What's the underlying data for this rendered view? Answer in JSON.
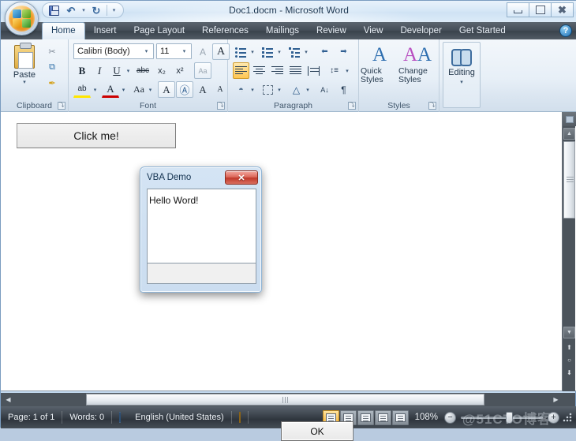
{
  "window": {
    "title": "Doc1.docm - Microsoft Word",
    "controls": {
      "minimize": "minimize-button",
      "maximize": "maximize-button",
      "close": "close-button"
    }
  },
  "quick_access": {
    "items": [
      {
        "name": "save",
        "icon": "save-icon"
      },
      {
        "name": "undo",
        "icon": "undo-icon",
        "glyph": "↶"
      },
      {
        "name": "redo",
        "icon": "redo-icon",
        "glyph": "↻"
      },
      {
        "name": "customize",
        "icon": "chevron-down-icon",
        "glyph": "▾"
      }
    ]
  },
  "ribbon": {
    "tabs": [
      {
        "label": "Home",
        "active": true
      },
      {
        "label": "Insert",
        "active": false
      },
      {
        "label": "Page Layout",
        "active": false
      },
      {
        "label": "References",
        "active": false
      },
      {
        "label": "Mailings",
        "active": false
      },
      {
        "label": "Review",
        "active": false
      },
      {
        "label": "View",
        "active": false
      },
      {
        "label": "Developer",
        "active": false
      },
      {
        "label": "Get Started",
        "active": false
      }
    ],
    "help_glyph": "?",
    "groups": {
      "clipboard": {
        "label": "Clipboard",
        "paste_label": "Paste",
        "paste_caret": "▾",
        "cut_glyph": "✂",
        "copy_glyph": "⧉",
        "format_painter_glyph": "✒"
      },
      "font": {
        "label": "Font",
        "font_name": "Calibri (Body)",
        "font_size": "11",
        "caret": "▾",
        "grow_font": "A",
        "shrink_font": "A",
        "clear_formatting": "A",
        "bold": "B",
        "italic": "I",
        "underline": "U",
        "strikethrough": "abc",
        "subscript": "x₂",
        "superscript": "x²",
        "change_case": "Aa",
        "text_highlight": "ab",
        "font_color": "A",
        "phonetic_guide": "A",
        "character_border": "A",
        "enclose_characters": "Ⓐ"
      },
      "paragraph": {
        "label": "Paragraph",
        "bullets": "bullets",
        "numbering": "numbering",
        "multilevel": "multilevel-list",
        "decrease_indent": "⬅",
        "increase_indent": "➡",
        "align_left": "align-left",
        "align_center": "align-center",
        "align_right": "align-right",
        "justify": "justify",
        "distributed": "distributed",
        "line_spacing": "line-spacing",
        "shading": "shading",
        "borders": "borders",
        "sort": "A↓",
        "show_marks": "¶"
      },
      "styles": {
        "label": "Styles",
        "quick_styles": "Quick Styles",
        "change_styles": "Change Styles",
        "caret": "▾"
      },
      "editing": {
        "label": "Editing",
        "button_label": "Editing",
        "caret": "▾"
      }
    },
    "dialog_launcher_glyph": "⤵"
  },
  "document": {
    "click_button_label": "Click me!"
  },
  "dialog": {
    "title": "VBA Demo",
    "message": "Hello Word!",
    "ok_label": "OK",
    "close_label": "✕",
    "close_color": "#c0392b"
  },
  "scrollbars": {
    "vertical": {
      "ruler_toggle": "view-ruler-toggle",
      "up_arrow": "▲",
      "down_arrow": "▼",
      "browse_prev": "⬆",
      "browse_object": "○",
      "browse_next": "⬇"
    },
    "horizontal": {
      "left_arrow": "◀",
      "right_arrow": "▶"
    }
  },
  "status_bar": {
    "page": "Page: 1 of 1",
    "words": "Words: 0",
    "language": "English (United States)",
    "zoom": "108%",
    "zoom_out": "−",
    "zoom_in": "+",
    "views": [
      {
        "name": "print-layout",
        "active": true
      },
      {
        "name": "full-screen-reading",
        "active": false
      },
      {
        "name": "web-layout",
        "active": false
      },
      {
        "name": "outline",
        "active": false
      },
      {
        "name": "draft",
        "active": false
      }
    ]
  },
  "watermark": "@51CTO博客"
}
